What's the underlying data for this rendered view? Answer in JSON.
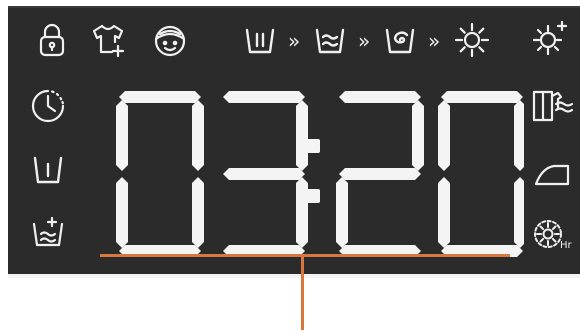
{
  "display": {
    "time": "03:20",
    "hours": "03",
    "minutes": "20"
  },
  "icons": {
    "top_row": [
      "child-lock-icon",
      "add-garment-icon",
      "kids-care-icon",
      "wash-icon",
      "rinse-icon",
      "spin-icon",
      "dry-icon",
      "dry-plus-icon"
    ],
    "left_column": [
      "delay-timer-icon",
      "wash-tub-icon",
      "extra-rinse-icon"
    ],
    "right_column": [
      "wardrobe-dry-icon",
      "iron-dry-icon",
      "timed-dry-icon"
    ]
  },
  "sequence_separator": "»",
  "colors": {
    "panel": "#2b2b2b",
    "segments": "#f4f4f4",
    "callout": "#d9773e"
  }
}
